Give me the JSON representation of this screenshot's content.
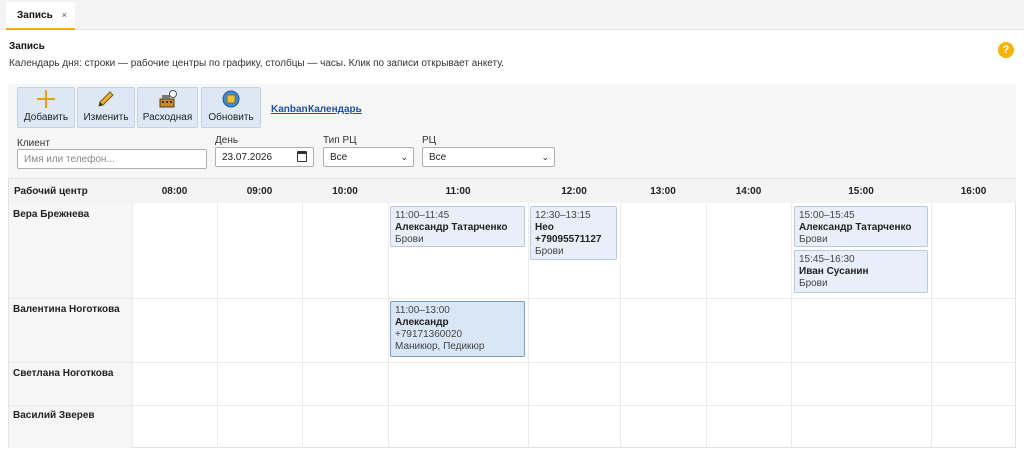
{
  "tab": {
    "label": "Запись",
    "close": "×"
  },
  "page": {
    "title": "Запись",
    "description": "Календарь дня: строки — рабочие центры по графику, столбцы — часы. Клик по записи открывает анкету.",
    "help": "?"
  },
  "toolbar": {
    "buttons": [
      {
        "label": "Добавить",
        "icon": "plus-icon"
      },
      {
        "label": "Изменить",
        "icon": "pencil-icon"
      },
      {
        "label": "Расходная",
        "icon": "cash-register-icon"
      },
      {
        "label": "Обновить",
        "icon": "refresh-icon"
      }
    ],
    "links": [
      "Kanban",
      "Календарь"
    ]
  },
  "filters": {
    "client": {
      "label": "Клиент",
      "placeholder": "Имя или телефон..."
    },
    "day": {
      "label": "День",
      "value": "23.07.2026"
    },
    "type": {
      "label": "Тип РЦ",
      "value": "Все"
    },
    "rc": {
      "label": "РЦ",
      "value": "Все"
    }
  },
  "grid": {
    "header_first": "Рабочий центр",
    "hours": [
      "08:00",
      "09:00",
      "10:00",
      "11:00",
      "12:00",
      "13:00",
      "14:00",
      "15:00",
      "16:00"
    ],
    "rows": [
      "Вера Брежнева",
      "Валентина Ноготкова",
      "Светлана Ноготкова",
      "Василий Зверев"
    ],
    "events": [
      {
        "time": "11:00–11:45",
        "name": "Александр Татарченко",
        "service": "Брови"
      },
      {
        "time": "12:30–13:15",
        "name": "Нео",
        "phone": "+79095571127",
        "service": "Брови"
      },
      {
        "time": "15:00–15:45",
        "name": "Александр Татарченко",
        "service": "Брови"
      },
      {
        "time": "15:45–16:30",
        "name": "Иван Сусанин",
        "service": "Брови"
      },
      {
        "time": "11:00–13:00",
        "name": "Александр",
        "phone": "+79171360020",
        "service": "Маникюр, Педикюр"
      }
    ]
  }
}
